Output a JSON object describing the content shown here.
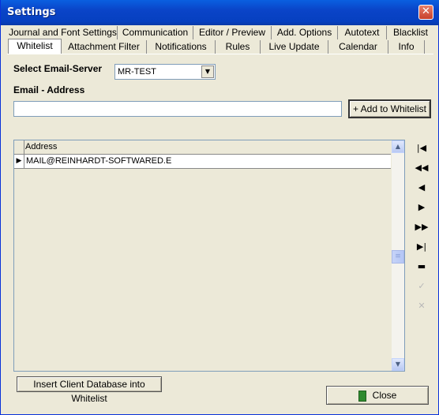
{
  "window": {
    "title": "Settings",
    "close_glyph": "✕"
  },
  "tabs_row1": [
    {
      "label": "Journal and Font Settings"
    },
    {
      "label": "Communication"
    },
    {
      "label": "Editor / Preview"
    },
    {
      "label": "Add. Options"
    },
    {
      "label": "Autotext"
    },
    {
      "label": "Blacklist"
    }
  ],
  "tabs_row2": [
    {
      "label": "Whitelist",
      "active": true
    },
    {
      "label": "Attachment Filter"
    },
    {
      "label": "Notifications"
    },
    {
      "label": "Rules"
    },
    {
      "label": "Live Update"
    },
    {
      "label": "Calendar"
    },
    {
      "label": "Info"
    }
  ],
  "form": {
    "server_label": "Select Email-Server",
    "server_value": "MR-TEST",
    "email_label": "Email - Address",
    "email_value": "",
    "add_button": "+ Add to Whitelist"
  },
  "grid": {
    "columns": [
      "Address"
    ],
    "rows": [
      {
        "address": "MAIL@REINHARDT-SOFTWARED.E",
        "current": true
      }
    ]
  },
  "navigator": [
    "first",
    "prior",
    "previous",
    "next",
    "next-page",
    "last",
    "delete",
    "post",
    "cancel"
  ],
  "footer": {
    "insert_button": "Insert Client Database into Whitelist",
    "close_button": "Close"
  },
  "colors": {
    "title_bar": "#0a4fd6",
    "face": "#ece9d8",
    "close_red": "#d0503a"
  }
}
